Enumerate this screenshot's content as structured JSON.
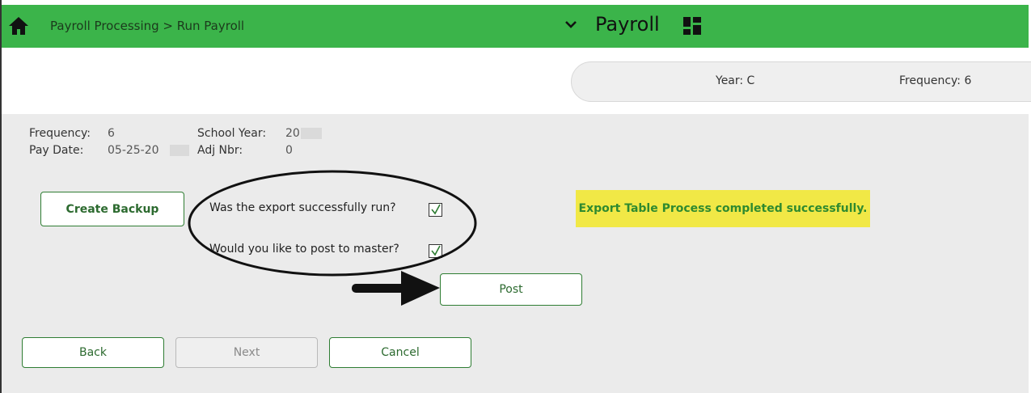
{
  "header": {
    "breadcrumb": "Payroll Processing > Run Payroll",
    "module_title": "Payroll"
  },
  "info": {
    "year_label": "Year: C",
    "frequency_label": "Frequency: 6"
  },
  "fields": {
    "frequency_label": "Frequency:",
    "frequency_value": "6",
    "school_year_label": "School Year:",
    "school_year_value": "20",
    "pay_date_label": "Pay Date:",
    "pay_date_value": "05-25-20",
    "adj_nbr_label": "Adj Nbr:",
    "adj_nbr_value": "0"
  },
  "buttons": {
    "create_backup": "Create Backup",
    "post": "Post",
    "back": "Back",
    "next": "Next",
    "cancel": "Cancel"
  },
  "questions": {
    "export_run": {
      "label": "Was the export successfully run?",
      "checked": true
    },
    "post_master": {
      "label": "Would you like to post to master?",
      "checked": true
    }
  },
  "status": {
    "message": "Export Table Process completed successfully."
  },
  "colors": {
    "header_green": "#3bb44a",
    "button_border": "#2f7d33",
    "message_bg": "#f1e846",
    "message_text": "#2f8a2f"
  },
  "icons": [
    "home-icon",
    "chevron-down-icon",
    "dashboard-grid-icon",
    "checkmark-icon",
    "arrow-right-icon"
  ]
}
